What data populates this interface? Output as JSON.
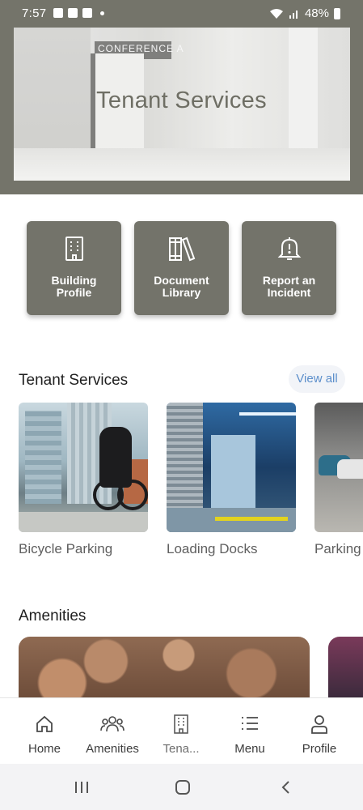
{
  "status_bar": {
    "time": "7:57",
    "battery": "48%"
  },
  "hero": {
    "title": "Tenant Services",
    "sign_text": "CONFERENCE A"
  },
  "quick_actions": [
    {
      "icon": "building-icon",
      "label_line1": "Building",
      "label_line2": "Profile"
    },
    {
      "icon": "books-icon",
      "label_line1": "Document",
      "label_line2": "Library"
    },
    {
      "icon": "alert-bell-icon",
      "label_line1": "Report an",
      "label_line2": "Incident"
    }
  ],
  "tenant_services": {
    "title": "Tenant Services",
    "view_all": "View all",
    "items": [
      {
        "label": "Bicycle Parking"
      },
      {
        "label": "Loading Docks"
      },
      {
        "label": "Parking"
      }
    ]
  },
  "amenities": {
    "title": "Amenities"
  },
  "bottom_nav": [
    {
      "icon": "home-icon",
      "label": "Home"
    },
    {
      "icon": "people-icon",
      "label": "Amenities"
    },
    {
      "icon": "building-icon",
      "label": "Tena..."
    },
    {
      "icon": "menu-list-icon",
      "label": "Menu"
    },
    {
      "icon": "person-icon",
      "label": "Profile"
    }
  ],
  "colors": {
    "brand": "#73736a",
    "link": "#5c8fcb",
    "nav_bg": "#f3f3f5"
  }
}
